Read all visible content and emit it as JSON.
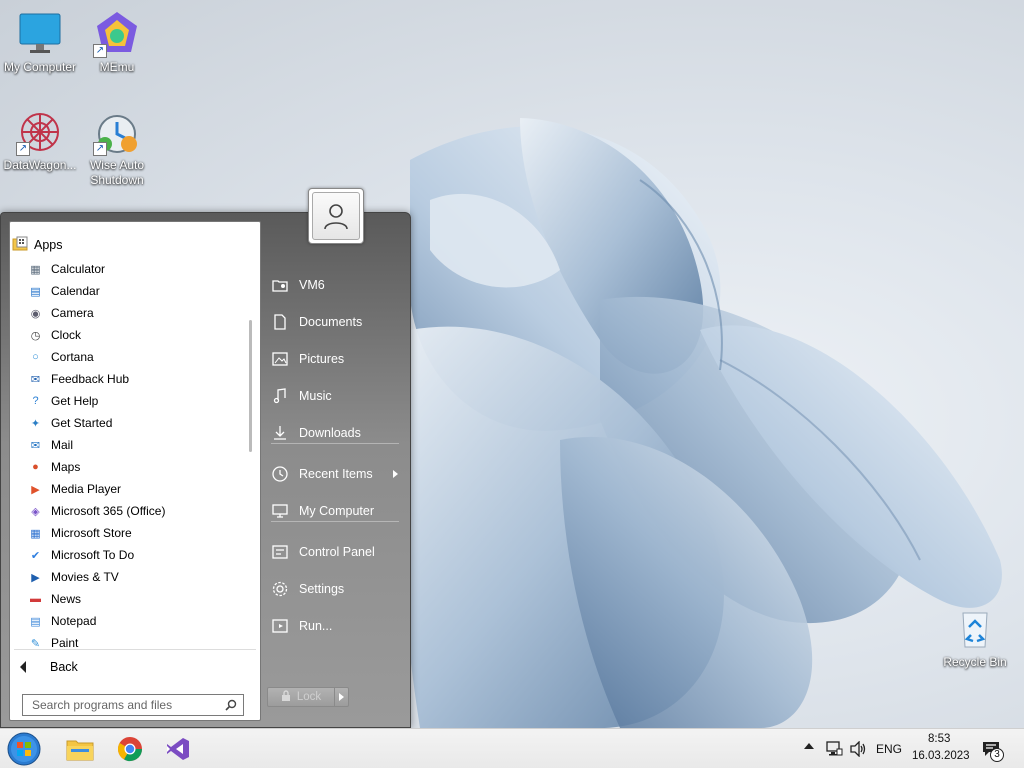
{
  "desktop": {
    "icons": [
      {
        "label": "My Computer",
        "icon": "monitor-icon"
      },
      {
        "label": "MEmu",
        "icon": "memu-icon"
      },
      {
        "label": "DataWagon...",
        "icon": "datawagon-icon"
      },
      {
        "label": "Wise Auto Shutdown",
        "icon": "wise-auto-shutdown-icon"
      },
      {
        "label": "Recycle Bin",
        "icon": "recycle-bin-icon"
      }
    ]
  },
  "start_menu": {
    "apps_header": "Apps",
    "apps": [
      {
        "label": "Calculator",
        "icon": "calculator-icon",
        "color": "#5a6b7c"
      },
      {
        "label": "Calendar",
        "icon": "calendar-icon",
        "color": "#1e6fc9"
      },
      {
        "label": "Camera",
        "icon": "camera-icon",
        "color": "#5d5d6e"
      },
      {
        "label": "Clock",
        "icon": "clock-icon",
        "color": "#444444"
      },
      {
        "label": "Cortana",
        "icon": "cortana-icon",
        "color": "#2f8fd8"
      },
      {
        "label": "Feedback Hub",
        "icon": "feedback-hub-icon",
        "color": "#1f5fae"
      },
      {
        "label": "Get Help",
        "icon": "get-help-icon",
        "color": "#2a7fd4"
      },
      {
        "label": "Get Started",
        "icon": "get-started-icon",
        "color": "#2c7fc6"
      },
      {
        "label": "Mail",
        "icon": "mail-icon",
        "color": "#1a6ec0"
      },
      {
        "label": "Maps",
        "icon": "maps-icon",
        "color": "#d94f2b"
      },
      {
        "label": "Media Player",
        "icon": "media-player-icon",
        "color": "#e0522b"
      },
      {
        "label": "Microsoft 365 (Office)",
        "icon": "office-icon",
        "color": "#7a54c9"
      },
      {
        "label": "Microsoft Store",
        "icon": "store-icon",
        "color": "#2a6fd0"
      },
      {
        "label": "Microsoft To Do",
        "icon": "todo-icon",
        "color": "#2f7fe0"
      },
      {
        "label": "Movies & TV",
        "icon": "movies-icon",
        "color": "#1f5fae"
      },
      {
        "label": "News",
        "icon": "news-icon",
        "color": "#d23a3a"
      },
      {
        "label": "Notepad",
        "icon": "notepad-icon",
        "color": "#3a86d8"
      },
      {
        "label": "Paint",
        "icon": "paint-icon",
        "color": "#2f8fd8"
      }
    ],
    "back_label": "Back",
    "search_placeholder": "Search programs and files",
    "right_items": [
      {
        "label": "VM6",
        "icon": "user-folder-icon"
      },
      {
        "label": "Documents",
        "icon": "documents-icon"
      },
      {
        "label": "Pictures",
        "icon": "pictures-icon"
      },
      {
        "label": "Music",
        "icon": "music-icon"
      },
      {
        "label": "Downloads",
        "icon": "downloads-icon"
      },
      {
        "label": "Recent Items",
        "icon": "recent-items-icon"
      },
      {
        "label": "My Computer",
        "icon": "computer-icon"
      },
      {
        "label": "Control Panel",
        "icon": "control-panel-icon"
      },
      {
        "label": "Settings",
        "icon": "settings-icon"
      },
      {
        "label": "Run...",
        "icon": "run-icon"
      }
    ],
    "lock_label": "Lock"
  },
  "taskbar": {
    "pinned": [
      "start-orb-icon",
      "file-explorer-icon",
      "chrome-icon",
      "visual-studio-icon"
    ],
    "language": "ENG",
    "time": "8:53",
    "date": "16.03.2023",
    "notification_count": "3"
  }
}
